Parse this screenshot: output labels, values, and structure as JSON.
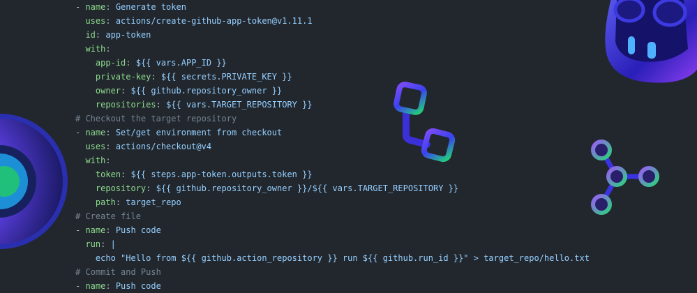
{
  "colors": {
    "background": "#22272e",
    "key": "#8ddb8c",
    "value": "#96d0ff",
    "comment": "#768390",
    "text": "#adbac7"
  },
  "code_lines": [
    {
      "indent": 0,
      "dash": true,
      "key": "name",
      "value": "Generate token"
    },
    {
      "indent": 2,
      "key": "uses",
      "value": "actions/create-github-app-token@v1.11.1"
    },
    {
      "indent": 2,
      "key": "id",
      "value": "app-token"
    },
    {
      "indent": 2,
      "key": "with",
      "value": ""
    },
    {
      "indent": 4,
      "key": "app-id",
      "value": "${{ vars.APP_ID }}"
    },
    {
      "indent": 4,
      "key": "private-key",
      "value": "${{ secrets.PRIVATE_KEY }}"
    },
    {
      "indent": 4,
      "key": "owner",
      "value": "${{ github.repository_owner }}"
    },
    {
      "indent": 4,
      "key": "repositories",
      "value": "${{ vars.TARGET_REPOSITORY }}"
    },
    {
      "indent": 0,
      "comment": "# Checkout the target repository"
    },
    {
      "indent": 0,
      "dash": true,
      "key": "name",
      "value": "Set/get environment from checkout"
    },
    {
      "indent": 2,
      "key": "uses",
      "value": "actions/checkout@v4"
    },
    {
      "indent": 2,
      "key": "with",
      "value": ""
    },
    {
      "indent": 4,
      "key": "token",
      "value": "${{ steps.app-token.outputs.token }}"
    },
    {
      "indent": 4,
      "key": "repository",
      "value": "${{ github.repository_owner }}/${{ vars.TARGET_REPOSITORY }}"
    },
    {
      "indent": 4,
      "key": "path",
      "value": "target_repo"
    },
    {
      "indent": 0,
      "comment": "# Create file"
    },
    {
      "indent": 0,
      "dash": true,
      "key": "name",
      "value": "Push code"
    },
    {
      "indent": 2,
      "key": "run",
      "value": "|"
    },
    {
      "indent": 4,
      "text": "echo \"Hello from ${{ github.action_repository }} run ${{ github.run_id }}\" > target_repo/hello.txt"
    },
    {
      "indent": 0,
      "comment": "# Commit and Push"
    },
    {
      "indent": 0,
      "dash": true,
      "key": "name",
      "value": "Push code"
    }
  ],
  "decorations": [
    "robot-mascot-image",
    "donut-ring-image",
    "branch-squares-icon",
    "node-graph-icon"
  ]
}
